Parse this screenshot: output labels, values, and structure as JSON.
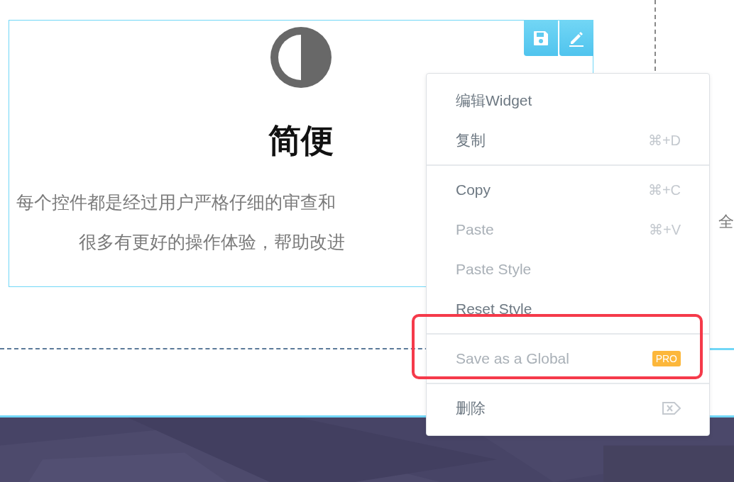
{
  "widget": {
    "title": "简便",
    "toolbar": [
      {
        "kind": "save"
      },
      {
        "kind": "edit"
      }
    ],
    "paragraph_lines": [
      "每个控件都是经过用户严格仔细的审查和",
      "很多有更好的操作体验，帮助改进"
    ]
  },
  "side_text": "全",
  "context_menu": {
    "groups": [
      {
        "items": [
          {
            "kind": "plain",
            "label": "编辑Widget",
            "disabled": false
          },
          {
            "kind": "shortcut",
            "label": "复制",
            "shortcut": "⌘+D",
            "disabled": false
          }
        ]
      },
      {
        "items": [
          {
            "kind": "shortcut",
            "label": "Copy",
            "shortcut": "⌘+C",
            "disabled": false
          },
          {
            "kind": "shortcut",
            "label": "Paste",
            "shortcut": "⌘+V",
            "disabled": true
          },
          {
            "kind": "plain",
            "label": "Paste Style",
            "disabled": true
          },
          {
            "kind": "plain",
            "label": "Reset Style",
            "disabled": false
          }
        ]
      },
      {
        "items": [
          {
            "kind": "badge",
            "label": "Save as a Global",
            "badge": "PRO",
            "disabled": true
          }
        ],
        "highlighted": true
      },
      {
        "items": [
          {
            "kind": "delete",
            "label": "删除",
            "disabled": false
          }
        ]
      }
    ]
  }
}
